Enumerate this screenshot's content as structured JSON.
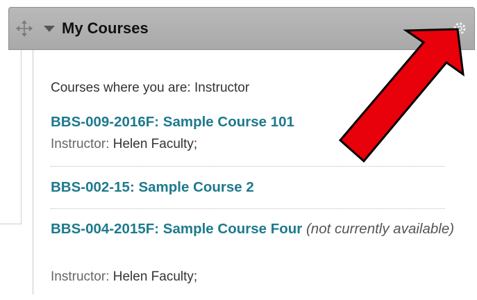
{
  "module": {
    "title": "My Courses",
    "drag_icon": "move-arrows-icon",
    "toggle_icon": "collapse-triangle-icon",
    "manage_icon": "gear-icon"
  },
  "role_heading": "Courses where you are: Instructor",
  "courses": [
    {
      "link": "BBS-009-2016F: Sample Course 101",
      "note": "",
      "instructor_label": "Instructor:",
      "instructor_name": " Helen Faculty;"
    },
    {
      "link": "BBS-002-15: Sample Course 2",
      "note": "",
      "instructor_label": "",
      "instructor_name": ""
    },
    {
      "link": "BBS-004-2015F: Sample Course Four",
      "note": "(not currently available)",
      "instructor_label": "Instructor:",
      "instructor_name": " Helen Faculty;"
    }
  ],
  "annotation": {
    "type": "red-arrow",
    "color": "#e8000a",
    "points_to": "gear-icon"
  },
  "colors": {
    "link": "#1d7a8c",
    "header": "#b0b0b0"
  }
}
